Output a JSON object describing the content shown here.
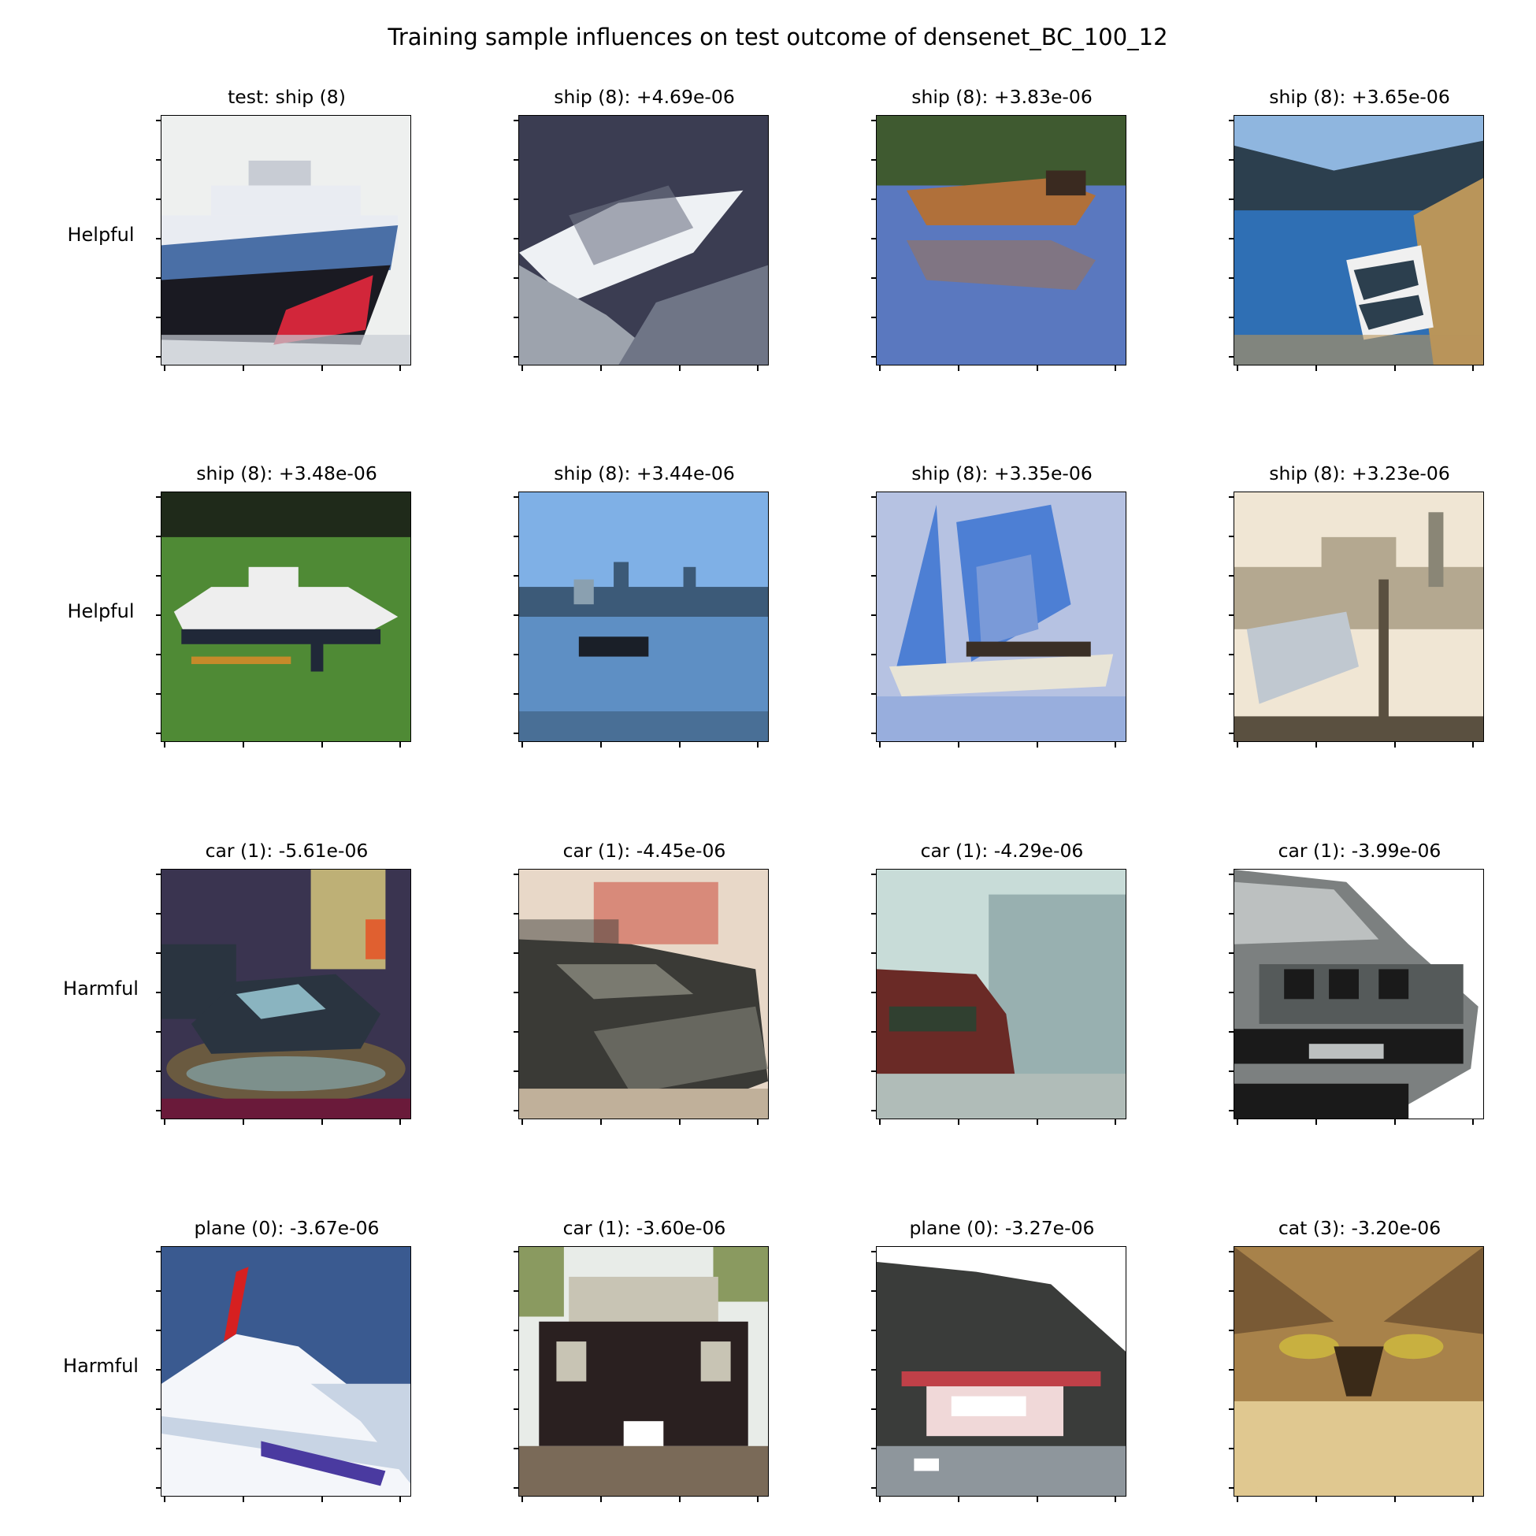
{
  "title": "Training sample influences on test outcome of densenet_BC_100_12",
  "rows": [
    {
      "label": "Helpful",
      "panels": [
        {
          "title": "test: ship (8)",
          "scene": "ship-white",
          "colors": [
            "#eef0ef",
            "#c8ccd4",
            "#e9ecf2",
            "#4a6fa6",
            "#1a1a22",
            "#d2263a"
          ]
        },
        {
          "title": "ship (8): +4.69e-06",
          "scene": "speedboat",
          "colors": [
            "#3b3d52",
            "#eef1f4",
            "#6f7586",
            "#9da3ad"
          ]
        },
        {
          "title": "ship (8): +3.83e-06",
          "scene": "rowboat",
          "colors": [
            "#3f5a30",
            "#5a78bf",
            "#b0703a",
            "#3a2a20"
          ]
        },
        {
          "title": "ship (8): +3.65e-06",
          "scene": "lake-boat",
          "colors": [
            "#8fb6df",
            "#2c3f4e",
            "#2f6fb4",
            "#b9955a",
            "#f0f0f0"
          ]
        }
      ]
    },
    {
      "label": "Helpful",
      "panels": [
        {
          "title": "ship (8): +3.48e-06",
          "scene": "grass-boat",
          "colors": [
            "#4f8a35",
            "#1f2a1a",
            "#eeeeee",
            "#202838",
            "#c68a2a"
          ]
        },
        {
          "title": "ship (8): +3.44e-06",
          "scene": "harbor",
          "colors": [
            "#7fb0e6",
            "#3c5a78",
            "#5e8fc4",
            "#1a1f28",
            "#8aa0b0"
          ]
        },
        {
          "title": "ship (8): +3.35e-06",
          "scene": "sailboat",
          "colors": [
            "#b6c2e2",
            "#4d7fd4",
            "#7a9ad8",
            "#e8e4d6",
            "#3a2f26"
          ]
        },
        {
          "title": "ship (8): +3.23e-06",
          "scene": "hazy-port",
          "colors": [
            "#f0e6d4",
            "#b4a890",
            "#8a8676",
            "#5a5040",
            "#c0c8d0"
          ]
        }
      ]
    },
    {
      "label": "Harmful",
      "panels": [
        {
          "title": "car (1): -5.61e-06",
          "scene": "car-show",
          "colors": [
            "#3a3450",
            "#2a3440",
            "#8ab4c0",
            "#6a5a40",
            "#e0d080",
            "#e06030"
          ]
        },
        {
          "title": "car (1): -4.45e-06",
          "scene": "old-car",
          "colors": [
            "#e8d8c8",
            "#d88a7a",
            "#3a3a36",
            "#7a7a70",
            "#c0b09a"
          ]
        },
        {
          "title": "car (1): -4.29e-06",
          "scene": "street-car",
          "colors": [
            "#c8dcd8",
            "#98b0b0",
            "#6a2a26",
            "#304030",
            "#b0bcb8"
          ]
        },
        {
          "title": "car (1): -3.99e-06",
          "scene": "suv-front",
          "colors": [
            "#ffffff",
            "#7c8080",
            "#bcc0c0",
            "#1a1a1a",
            "#555a5a"
          ]
        }
      ]
    },
    {
      "label": "Harmful",
      "panels": [
        {
          "title": "plane (0): -3.67e-06",
          "scene": "jet",
          "colors": [
            "#3a5a90",
            "#f4f6fa",
            "#c8d4e4",
            "#d62020",
            "#4a3aa0"
          ]
        },
        {
          "title": "car (1): -3.60e-06",
          "scene": "car-front",
          "colors": [
            "#e8ece8",
            "#8a9a60",
            "#2a2020",
            "#c8c4b4",
            "#7a6a58"
          ]
        },
        {
          "title": "plane (0): -3.27e-06",
          "scene": "biplane",
          "colors": [
            "#ffffff",
            "#3a3c3a",
            "#c04048",
            "#8a9aa0",
            "#f0d8d8"
          ]
        },
        {
          "title": "cat (3): -3.20e-06",
          "scene": "cat-face",
          "colors": [
            "#a8824a",
            "#5a4028",
            "#e0c890",
            "#c8b040",
            "#3a2a18"
          ]
        }
      ]
    }
  ]
}
